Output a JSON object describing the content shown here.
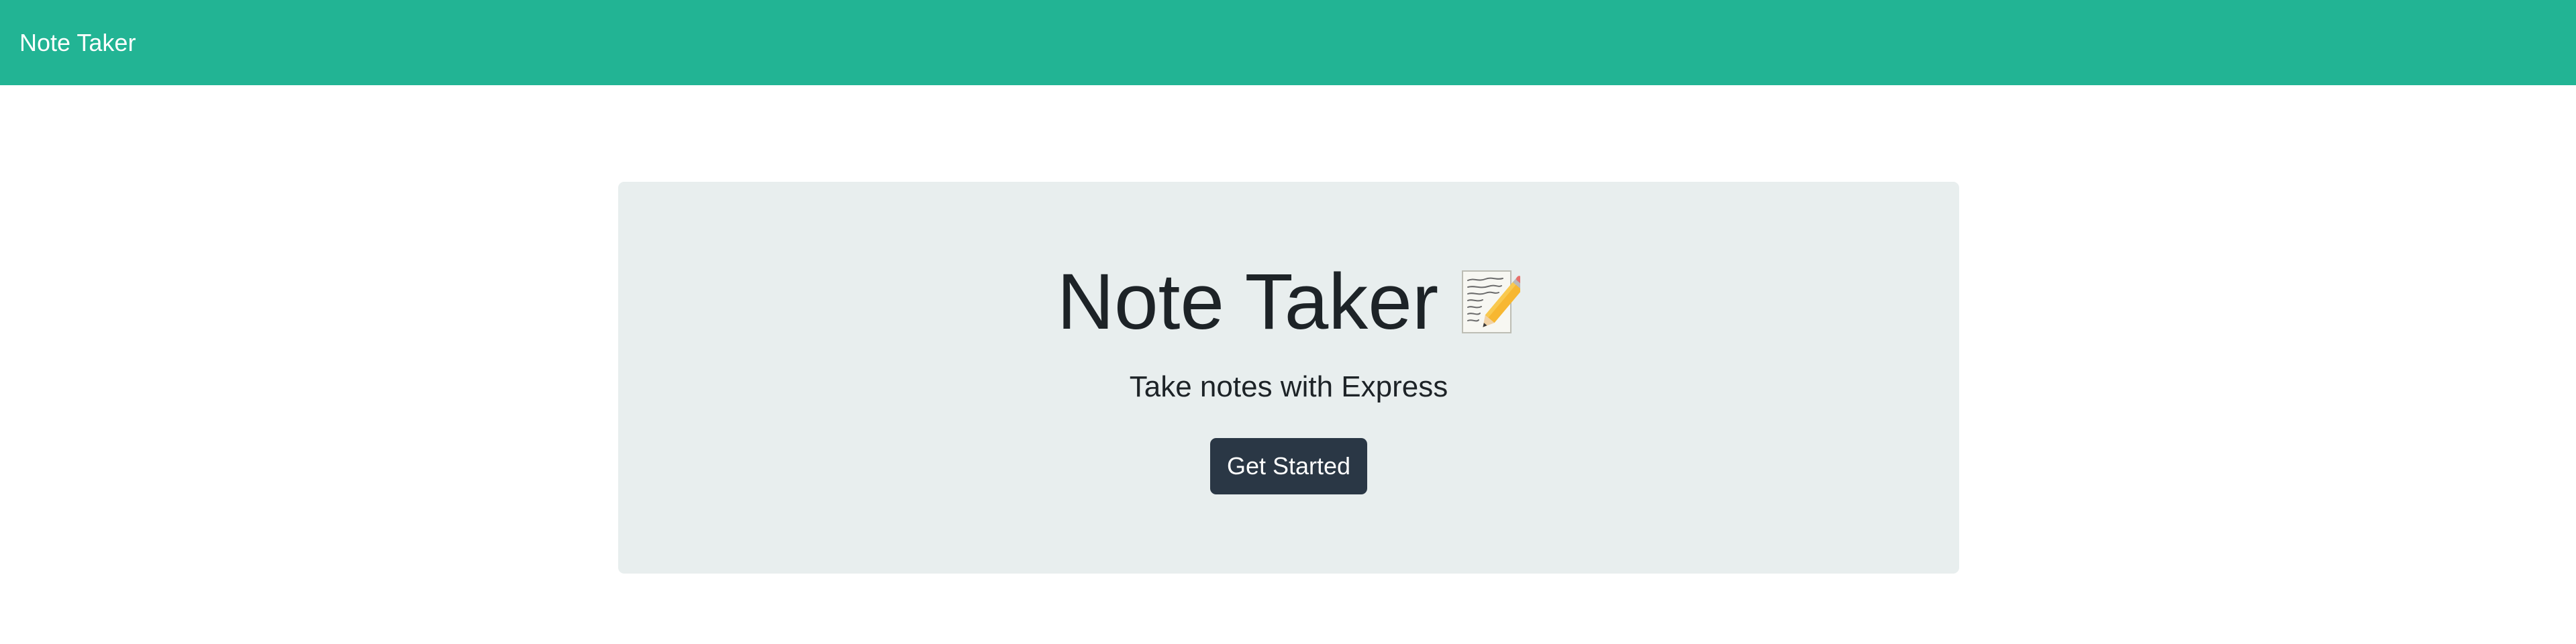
{
  "navbar": {
    "brand": "Note Taker",
    "background_color": "#22b494"
  },
  "hero": {
    "title": "Note Taker",
    "title_icon": "memo-icon",
    "subtitle": "Take notes with Express",
    "button_label": "Get Started",
    "button_color": "#2a3745",
    "panel_color": "#e8eeee"
  }
}
